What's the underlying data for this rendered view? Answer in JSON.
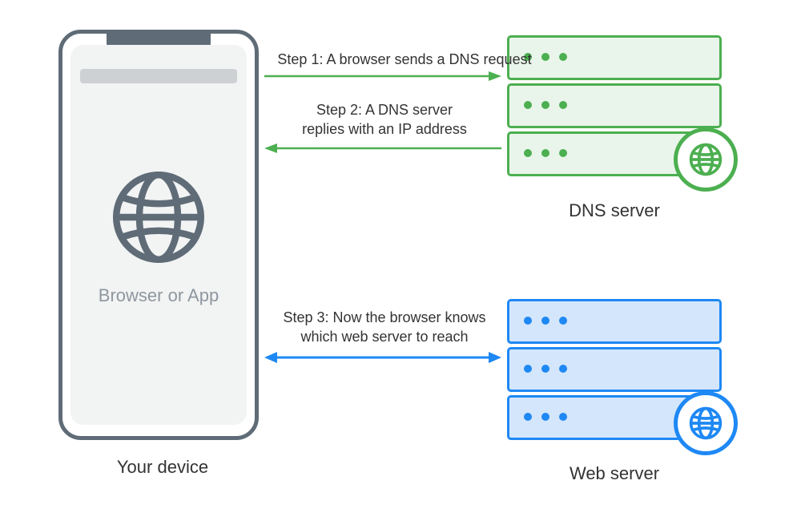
{
  "phone": {
    "app_label": "Browser or App",
    "caption": "Your device"
  },
  "dns": {
    "caption": "DNS server"
  },
  "web": {
    "caption": "Web server"
  },
  "steps": {
    "s1": "Step 1: A browser sends a DNS request",
    "s2_line1": "Step 2: A DNS server",
    "s2_line2": "replies with an IP address",
    "s3_line1": "Step 3: Now the browser knows",
    "s3_line2": "which web server to reach"
  },
  "colors": {
    "phone": "#5F6C77",
    "dns": "#4CAF50",
    "web": "#1E88F4"
  }
}
